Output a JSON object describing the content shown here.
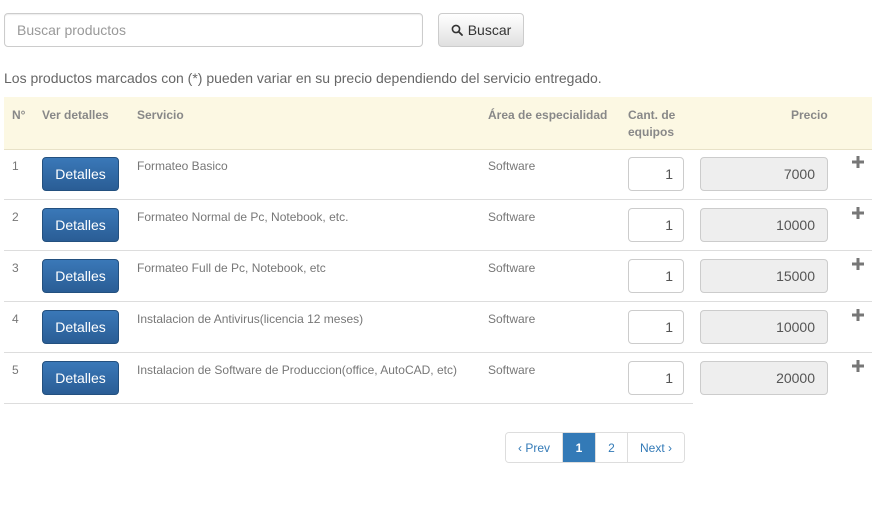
{
  "search": {
    "placeholder": "Buscar productos",
    "button_label": "Buscar"
  },
  "notice": "Los productos marcados con (*) pueden variar en su precio dependiendo del servicio entregado.",
  "table": {
    "headers": {
      "num": "N°",
      "ver": "Ver detalles",
      "servicio": "Servicio",
      "area": "Área de especialidad",
      "cant": "Cant. de equipos",
      "precio": "Precio"
    },
    "rows": [
      {
        "num": "1",
        "details_label": "Detalles",
        "servicio": "Formateo Basico",
        "area": "Software",
        "qty": "1",
        "price": "7000"
      },
      {
        "num": "2",
        "details_label": "Detalles",
        "servicio": "Formateo Normal de Pc, Notebook, etc.",
        "area": "Software",
        "qty": "1",
        "price": "10000"
      },
      {
        "num": "3",
        "details_label": "Detalles",
        "servicio": "Formateo Full de Pc, Notebook, etc",
        "area": "Software",
        "qty": "1",
        "price": "15000"
      },
      {
        "num": "4",
        "details_label": "Detalles",
        "servicio": "Instalacion de Antivirus(licencia 12 meses)",
        "area": "Software",
        "qty": "1",
        "price": "10000"
      },
      {
        "num": "5",
        "details_label": "Detalles",
        "servicio": "Instalacion de Software de Produccion(office, AutoCAD, etc)",
        "area": "Software",
        "qty": "1",
        "price": "20000"
      }
    ]
  },
  "pagination": {
    "prev_label": "‹ Prev",
    "pages": [
      "1",
      "2"
    ],
    "active_page": "1",
    "next_label": "Next ›"
  },
  "colors": {
    "header_bg": "#fcf8e3",
    "primary_button": "#2f6aa6",
    "link": "#337ab7"
  }
}
